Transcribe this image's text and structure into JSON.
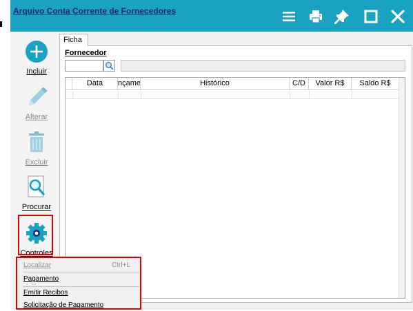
{
  "window": {
    "title": "Arquivo Conta Corrente de Fornecedores",
    "controls": [
      "menu-icon",
      "print-icon",
      "pin-icon",
      "maximize-icon",
      "close-icon"
    ]
  },
  "toolbar": {
    "items": [
      {
        "label": "Incluir",
        "icon": "plus-circle-icon",
        "enabled": true
      },
      {
        "label": "Alterar",
        "icon": "pencil-icon",
        "enabled": false
      },
      {
        "label": "Excluir",
        "icon": "trash-icon",
        "enabled": false
      },
      {
        "label": "Procurar",
        "icon": "magnifier-document-icon",
        "enabled": true
      },
      {
        "label": "Controles",
        "icon": "gear-icon",
        "enabled": true
      }
    ]
  },
  "tab": {
    "label": "Ficha"
  },
  "fornecedor": {
    "label": "Fornecedor",
    "code": "",
    "name": ""
  },
  "grid": {
    "columns": [
      "Data",
      "nçame",
      "Histórico",
      "C/D",
      "Valor R$",
      "Saldo R$"
    ],
    "rows": []
  },
  "context_menu": {
    "items": [
      {
        "label": "Localizar",
        "shortcut": "Ctrl+L",
        "enabled": false
      },
      {
        "label": "Pagamento",
        "shortcut": "",
        "enabled": true
      },
      {
        "label": "Emitir Recibos",
        "shortcut": "",
        "enabled": true
      },
      {
        "label": "Solicitação de Pagamento",
        "shortcut": "",
        "enabled": true
      }
    ]
  },
  "colors": {
    "titlebar": "#1aa2c2",
    "title_text": "#1e2a78",
    "highlight": "#e00000"
  }
}
